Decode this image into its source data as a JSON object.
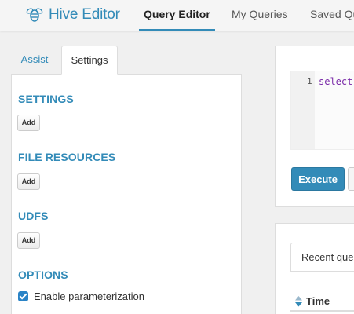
{
  "app": {
    "brand_title": "Hive Editor",
    "brand_icon": "hive-bee-icon",
    "accent_color": "#338bb8"
  },
  "nav": {
    "tabs": [
      {
        "label": "Query Editor",
        "active": true
      },
      {
        "label": "My Queries",
        "active": false
      },
      {
        "label": "Saved Qu",
        "active": false
      }
    ]
  },
  "left_panel": {
    "tabs": [
      {
        "label": "Assist",
        "active": false
      },
      {
        "label": "Settings",
        "active": true
      }
    ],
    "sections": [
      {
        "title": "SETTINGS",
        "button": "Add"
      },
      {
        "title": "FILE RESOURCES",
        "button": "Add"
      },
      {
        "title": "UDFS",
        "button": "Add"
      },
      {
        "title": "OPTIONS"
      }
    ],
    "options": [
      {
        "label": "Enable parameterization",
        "checked": true
      }
    ]
  },
  "editor": {
    "line_number": "1",
    "code": "select"
  },
  "actions": {
    "execute_label": "Execute"
  },
  "results": {
    "tab_label": "Recent que",
    "column_header": "Time"
  }
}
